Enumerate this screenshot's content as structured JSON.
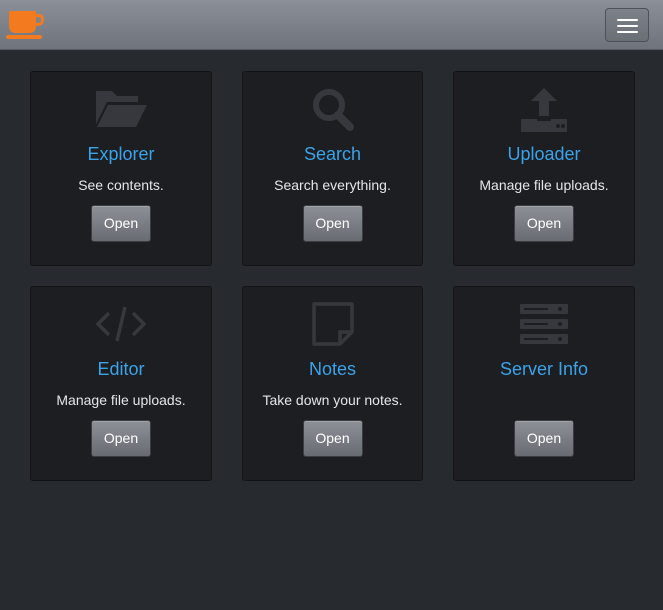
{
  "navbar": {
    "brand_icon": "coffee-cup-icon",
    "brand_color": "#f47a20",
    "menu_icon": "hamburger-menu-icon"
  },
  "accent_color": "#3aa3ea",
  "cards": [
    {
      "icon": "folder-open-icon",
      "title": "Explorer",
      "description": "See contents.",
      "button": "Open"
    },
    {
      "icon": "search-icon",
      "title": "Search",
      "description": "Search everything.",
      "button": "Open"
    },
    {
      "icon": "upload-icon",
      "title": "Uploader",
      "description": "Manage file uploads.",
      "button": "Open"
    },
    {
      "icon": "code-icon",
      "title": "Editor",
      "description": "Manage file uploads.",
      "button": "Open"
    },
    {
      "icon": "sticky-note-icon",
      "title": "Notes",
      "description": "Take down your notes.",
      "button": "Open"
    },
    {
      "icon": "server-icon",
      "title": "Server Info",
      "description": "",
      "button": "Open"
    }
  ]
}
